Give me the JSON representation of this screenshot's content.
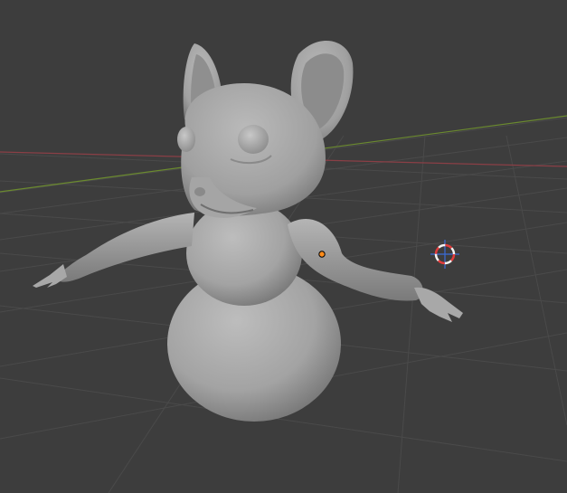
{
  "viewport": {
    "background_color": "#3d3d3d",
    "grid_color": "#4a4a4a",
    "x_axis_color": "#8a3f46",
    "y_axis_color": "#6b8a2f"
  },
  "model": {
    "base_color": "#a3a3a3",
    "shadow_color": "#6d6d6d",
    "highlight_color": "#bdbdbd"
  },
  "object_origin": {
    "icon": "origin-dot-icon",
    "color": "#ff8c1a"
  },
  "cursor_3d": {
    "icon": "3d-cursor-icon",
    "ring_color_a": "#e23b3b",
    "ring_color_b": "#f2f2f2",
    "axis_color": "#3b6bd8"
  }
}
